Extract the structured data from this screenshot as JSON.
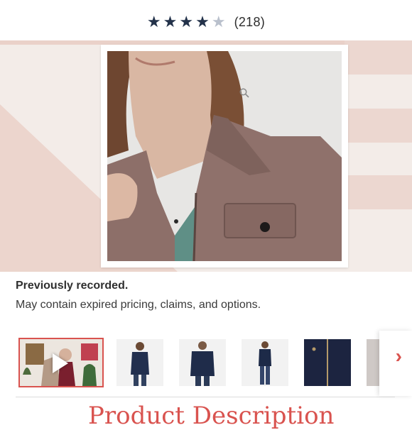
{
  "rating": {
    "stars": [
      "★",
      "★",
      "★",
      "★",
      "★"
    ],
    "filled": 4,
    "review_count": "(218)"
  },
  "hero": {
    "zoom_icon": "magnifier-icon",
    "background_color": "#f3ece8",
    "accent_color": "#ecd7d0"
  },
  "notice": {
    "title": "Previously recorded.",
    "subtitle": "May contain expired pricing, claims, and options."
  },
  "thumbnails": {
    "items": [
      {
        "kind": "video",
        "icon": "play-icon"
      },
      {
        "kind": "image"
      },
      {
        "kind": "image"
      },
      {
        "kind": "image"
      },
      {
        "kind": "image"
      },
      {
        "kind": "image"
      }
    ],
    "next_icon": "chevron-right-icon",
    "next_glyph": "›",
    "accent_color": "#d9534f"
  },
  "section": {
    "heading": "Product Description"
  }
}
